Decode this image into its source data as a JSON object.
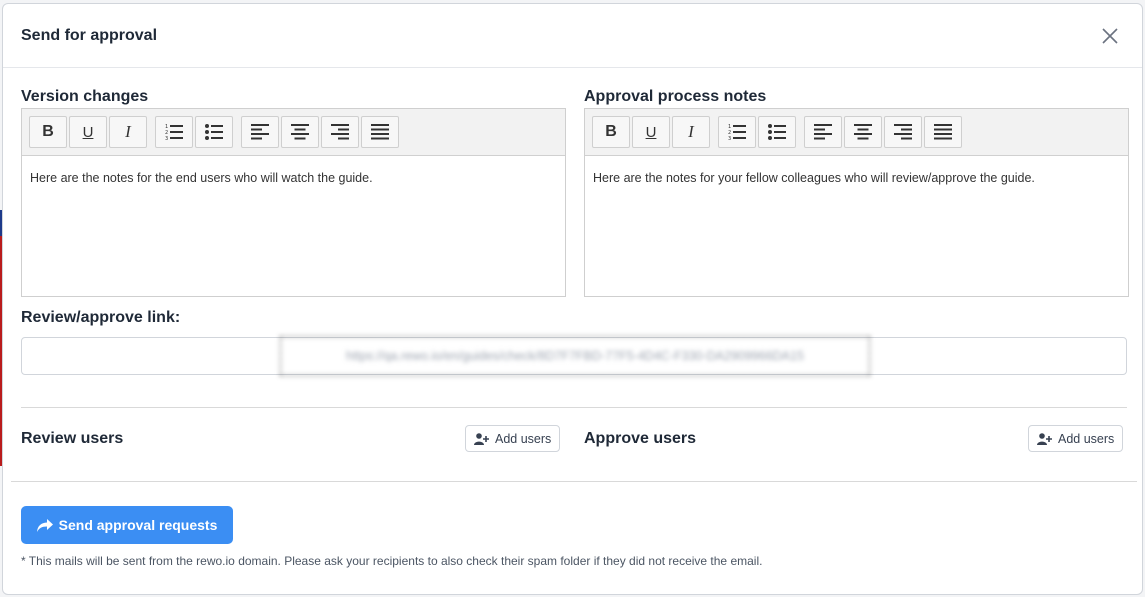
{
  "modal": {
    "title": "Send for approval"
  },
  "editors": [
    {
      "label": "Version changes",
      "content": "Here are the notes for the end users who will watch the guide."
    },
    {
      "label": "Approval process notes",
      "content": "Here are the notes for your fellow colleagues who will review/approve the guide."
    }
  ],
  "toolbar": {
    "buttons": [
      "bold-icon",
      "underline-icon",
      "italic-icon",
      "ordered-list-icon",
      "unordered-list-icon",
      "align-left-icon",
      "align-center-icon",
      "align-right-icon",
      "align-justify-icon"
    ],
    "bold_glyph": "B",
    "underline_glyph": "U",
    "italic_glyph": "I"
  },
  "review_link": {
    "label": "Review/approve link:",
    "value": "https://qa.rewo.io/en/guides/check/8D7F7FBD-77F5-4D4C-F330-DA2909966DA15"
  },
  "review_users": {
    "title": "Review users",
    "add_label": "Add users"
  },
  "approve_users": {
    "title": "Approve users",
    "add_label": "Add users"
  },
  "send_button": {
    "label": "Send approval requests"
  },
  "note": "* This mails will be sent from the rewo.io domain. Please ask your recipients to also check their spam folder if they did not receive the email.",
  "colors": {
    "primary": "#3b8ef3",
    "toolbar_bg": "#f2f2f2"
  }
}
